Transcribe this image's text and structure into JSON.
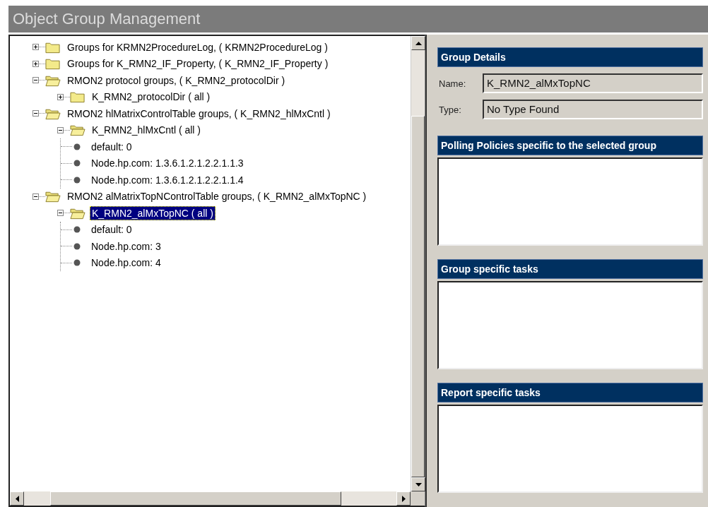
{
  "window": {
    "title": "Object Group Management"
  },
  "tree": {
    "nodes": [
      {
        "kind": "group",
        "label": "Groups for KRMN2ProcedureLog, ( KRMN2ProcedureLog )",
        "expanded": false,
        "selected": false
      },
      {
        "kind": "group",
        "label": "Groups for K_RMN2_IF_Property, ( K_RMN2_IF_Property )",
        "expanded": false,
        "selected": false
      },
      {
        "kind": "group",
        "label": "RMON2 protocol groups, ( K_RMN2_protocolDir )",
        "expanded": true,
        "selected": false,
        "children": [
          {
            "kind": "group",
            "label": "K_RMN2_protocolDir ( all )",
            "expanded": false,
            "selected": false
          }
        ]
      },
      {
        "kind": "group",
        "label": "RMON2 hlMatrixControlTable groups, ( K_RMN2_hlMxCntl )",
        "expanded": true,
        "selected": false,
        "children": [
          {
            "kind": "group",
            "label": "K_RMN2_hlMxCntl ( all )",
            "expanded": true,
            "selected": false,
            "children": [
              {
                "kind": "leaf",
                "label": "default: 0",
                "selected": false
              },
              {
                "kind": "leaf",
                "label": "Node.hp.com: 1.3.6.1.2.1.2.2.1.1.3",
                "selected": false
              },
              {
                "kind": "leaf",
                "label": "Node.hp.com: 1.3.6.1.2.1.2.2.1.1.4",
                "selected": false
              }
            ]
          }
        ]
      },
      {
        "kind": "group",
        "label": "RMON2 alMatrixTopNControlTable groups, ( K_RMN2_alMxTopNC )",
        "expanded": true,
        "selected": false,
        "children": [
          {
            "kind": "group",
            "label": "K_RMN2_alMxTopNC ( all )",
            "expanded": true,
            "selected": true,
            "children": [
              {
                "kind": "leaf",
                "label": "default: 0",
                "selected": false
              },
              {
                "kind": "leaf",
                "label": "Node.hp.com: 3",
                "selected": false
              },
              {
                "kind": "leaf",
                "label": "Node.hp.com: 4",
                "selected": false
              }
            ]
          }
        ]
      }
    ]
  },
  "details": {
    "title": "Group Details",
    "fields": [
      {
        "label": "Name:",
        "value": "K_RMN2_alMxTopNC"
      },
      {
        "label": "Type:",
        "value": "No Type Found"
      }
    ]
  },
  "sections": [
    {
      "title": "Polling Policies specific to the selected group"
    },
    {
      "title": "Group specific tasks"
    },
    {
      "title": "Report specific tasks"
    }
  ]
}
